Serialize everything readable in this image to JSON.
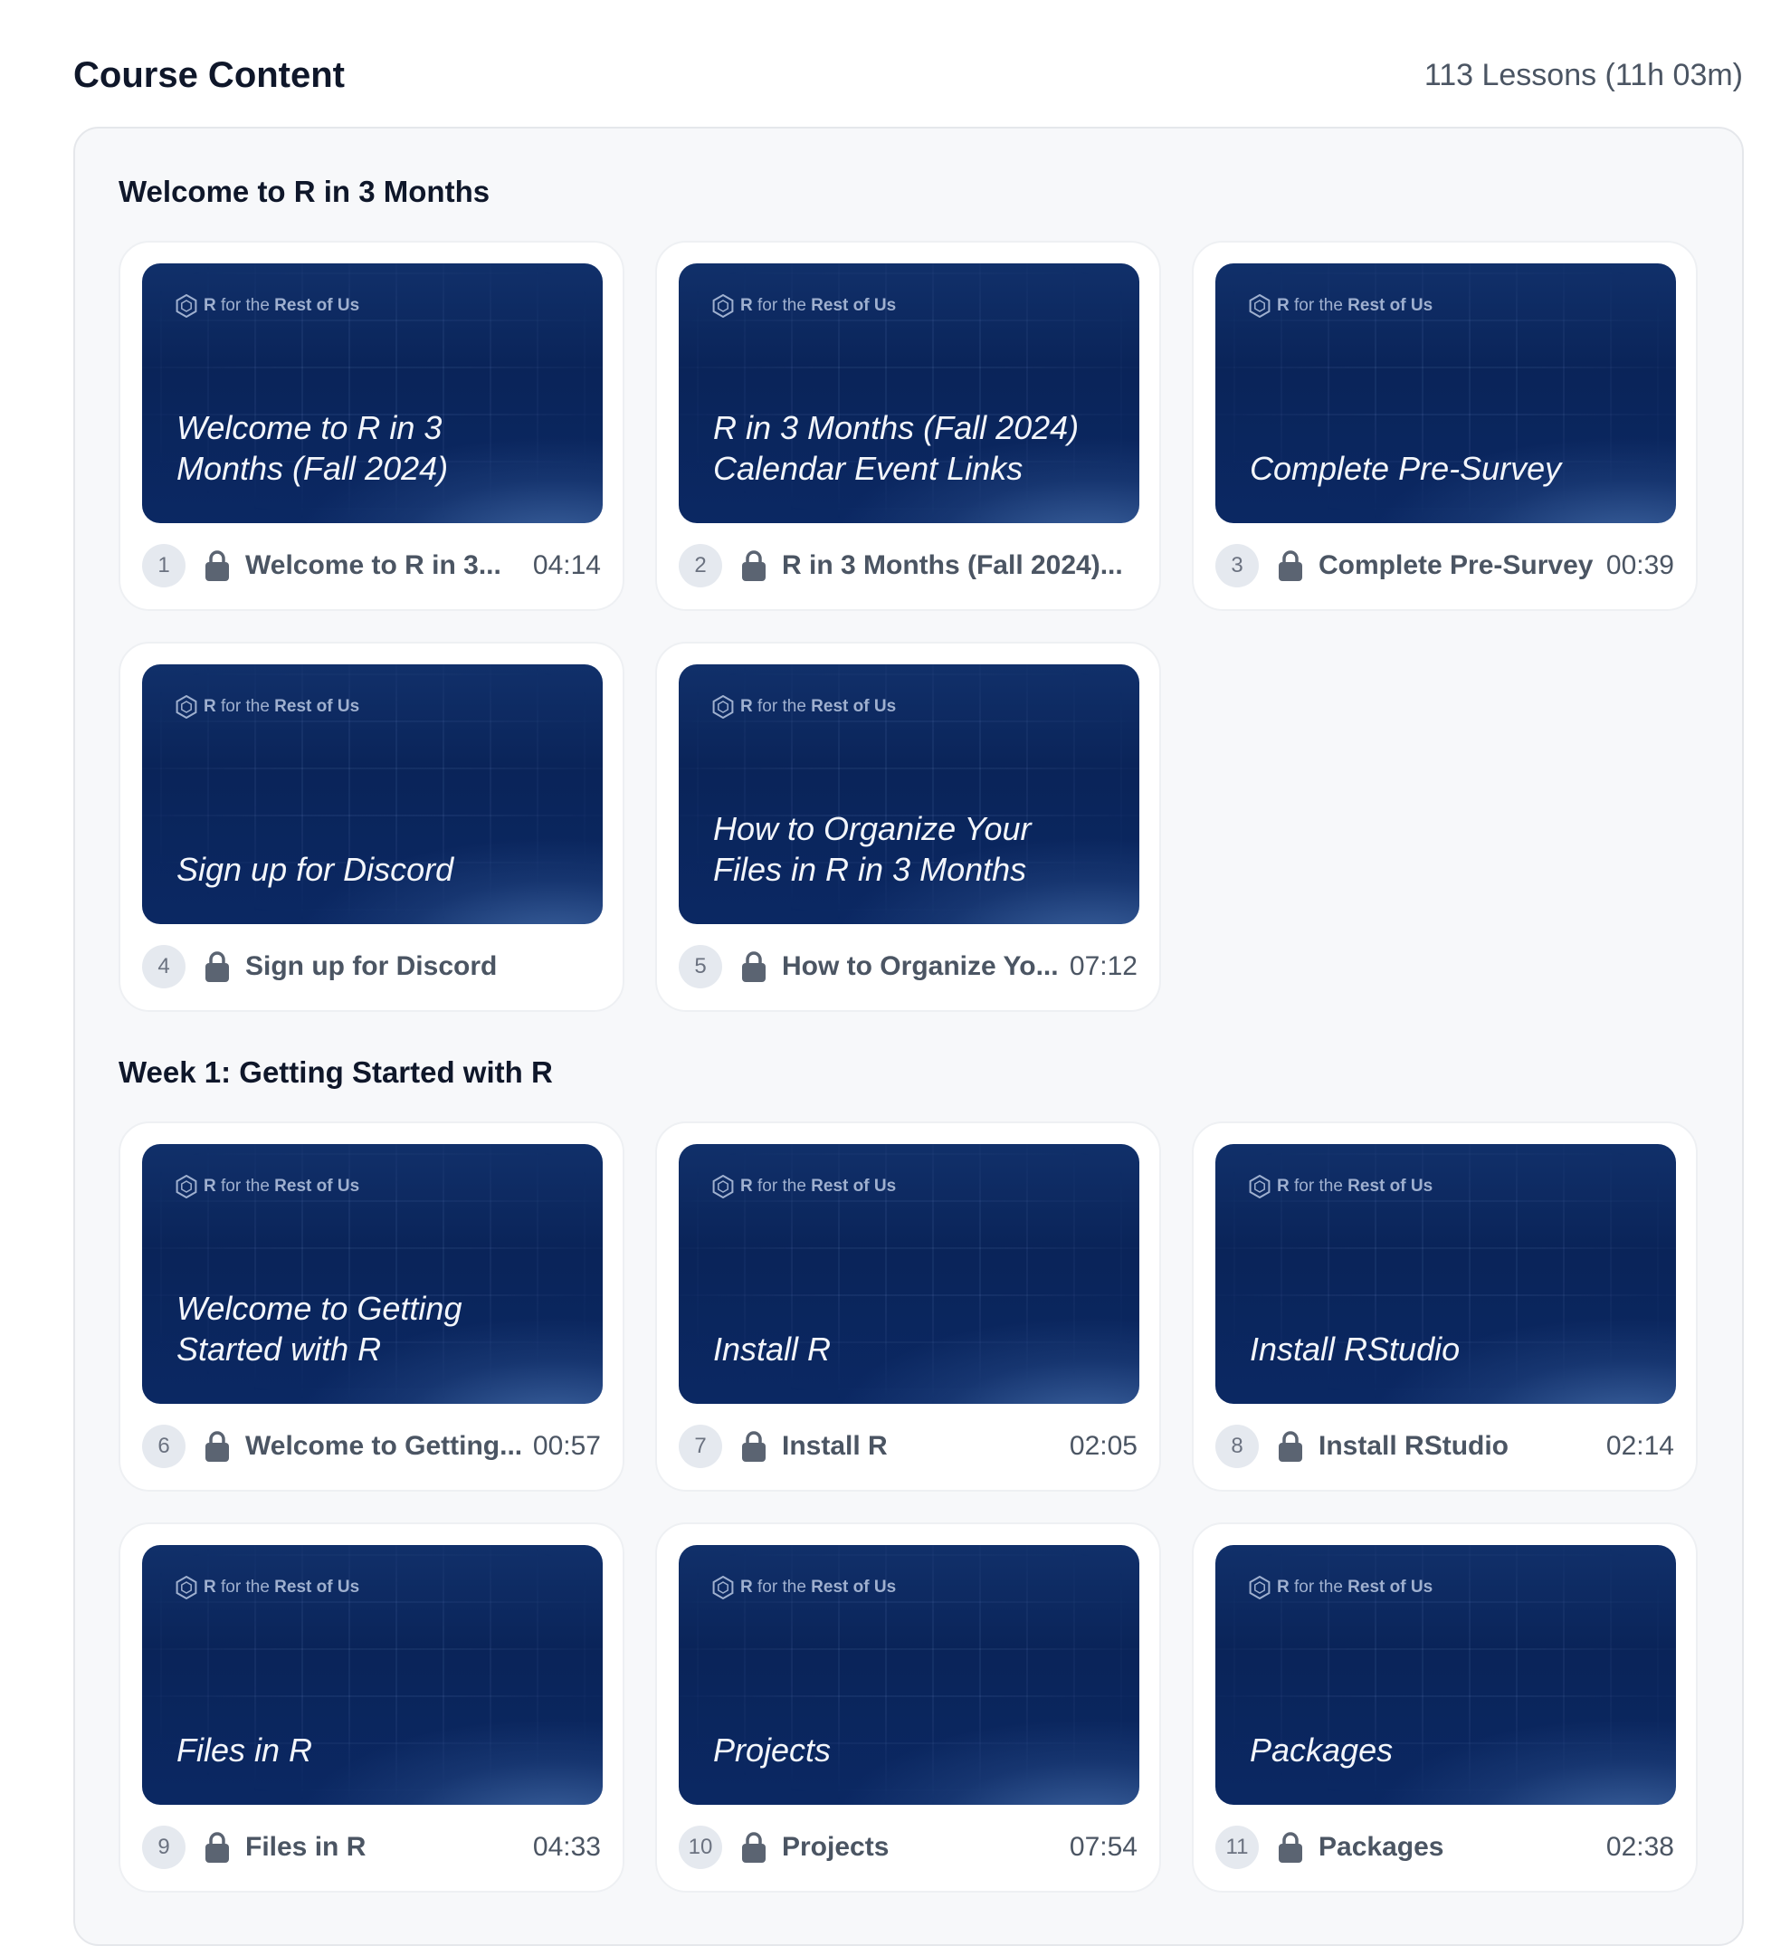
{
  "header": {
    "title": "Course Content",
    "lesson_summary": "113 Lessons (11h 03m)"
  },
  "brand": {
    "name_r": "R",
    "name_mid": "for the",
    "name_end": "Rest of Us"
  },
  "sections": [
    {
      "title": "Welcome to R in 3 Months",
      "lessons": [
        {
          "number": "1",
          "thumb_title": "Welcome to R in 3 Months (Fall 2024)",
          "label": "Welcome to R in 3...",
          "duration": "04:14",
          "icon": "lock-icon"
        },
        {
          "number": "2",
          "thumb_title": "R in 3 Months (Fall 2024) Calendar Event Links",
          "label": "R in 3 Months (Fall 2024)...",
          "duration": "",
          "icon": "lock-icon"
        },
        {
          "number": "3",
          "thumb_title": "Complete Pre-Survey",
          "label": "Complete Pre-Survey",
          "duration": "00:39",
          "icon": "lock-icon"
        },
        {
          "number": "4",
          "thumb_title": "Sign up for Discord",
          "label": "Sign up for Discord",
          "duration": "",
          "icon": "lock-icon"
        },
        {
          "number": "5",
          "thumb_title": "How to Organize Your Files in R in 3 Months",
          "label": "How to Organize Yo...",
          "duration": "07:12",
          "icon": "lock-icon"
        }
      ]
    },
    {
      "title": "Week 1: Getting Started with R",
      "lessons": [
        {
          "number": "6",
          "thumb_title": "Welcome to Getting Started with R",
          "label": "Welcome to Getting...",
          "duration": "00:57",
          "icon": "lock-icon"
        },
        {
          "number": "7",
          "thumb_title": "Install R",
          "label": "Install R",
          "duration": "02:05",
          "icon": "lock-icon"
        },
        {
          "number": "8",
          "thumb_title": "Install RStudio",
          "label": "Install RStudio",
          "duration": "02:14",
          "icon": "lock-icon"
        },
        {
          "number": "9",
          "thumb_title": "Files in R",
          "label": "Files in R",
          "duration": "04:33",
          "icon": "lock-icon"
        },
        {
          "number": "10",
          "thumb_title": "Projects",
          "label": "Projects",
          "duration": "07:54",
          "icon": "lock-icon"
        },
        {
          "number": "11",
          "thumb_title": "Packages",
          "label": "Packages",
          "duration": "02:38",
          "icon": "lock-icon"
        }
      ]
    }
  ],
  "colors": {
    "thumbnail_bg": "#0a2459",
    "panel_bg": "#f7f8fa",
    "badge_bg": "#e5e9ef",
    "text_muted": "#4b5563"
  }
}
